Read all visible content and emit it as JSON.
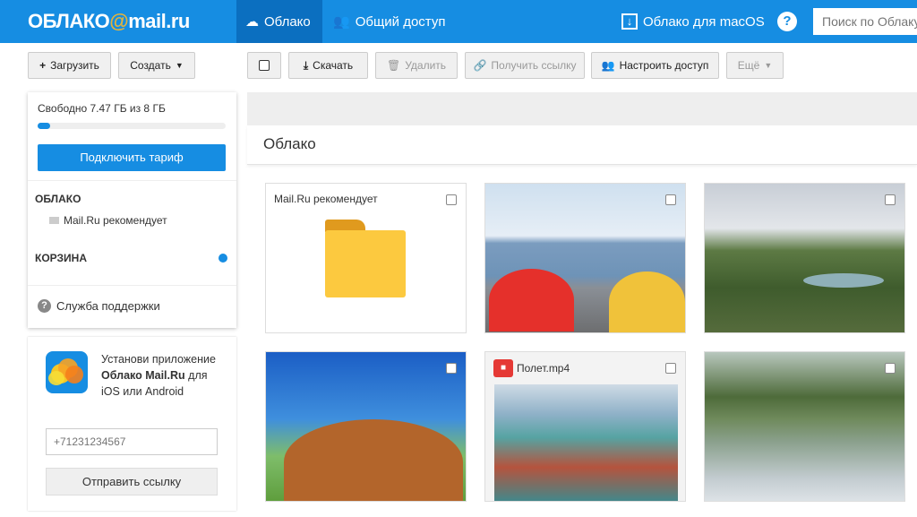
{
  "header": {
    "logo_prefix": "ОБЛАКО",
    "logo_at": "@",
    "logo_suffix": "mail.ru",
    "tabs": [
      {
        "label": "Облако"
      },
      {
        "label": "Общий доступ"
      }
    ],
    "desktop_app": "Облако для macOS",
    "help": "?",
    "search_placeholder": "Поиск по Облаку"
  },
  "toolbar": {
    "upload": "Загрузить",
    "create": "Создать",
    "download": "Скачать",
    "delete": "Удалить",
    "get_link": "Получить ссылку",
    "access": "Настроить доступ",
    "more": "Ещё"
  },
  "sidebar": {
    "storage_text": "Свободно 7.47 ГБ из 8 ГБ",
    "storage_used_fraction": 0.066,
    "tariff_button": "Подключить тариф",
    "cloud_heading": "ОБЛАКО",
    "folders": [
      {
        "label": "Mail.Ru рекомендует"
      }
    ],
    "trash_heading": "КОРЗИНА",
    "support": "Служба поддержки"
  },
  "promo": {
    "text1": "Установи приложение ",
    "bold1": "Облако Mail.Ru",
    "text2": " для iOS или Android",
    "phone_placeholder": "+71231234567",
    "send_button": "Отправить ссылку"
  },
  "main": {
    "title": "Облако",
    "items": [
      {
        "type": "folder",
        "label": "Mail.Ru рекомендует"
      },
      {
        "type": "image"
      },
      {
        "type": "image"
      },
      {
        "type": "image"
      },
      {
        "type": "video",
        "label": "Полет.mp4"
      },
      {
        "type": "image"
      }
    ]
  },
  "colors": {
    "brand": "#168de2",
    "active_tab": "#0b6fc0",
    "accent_gold": "#e2b33d"
  }
}
